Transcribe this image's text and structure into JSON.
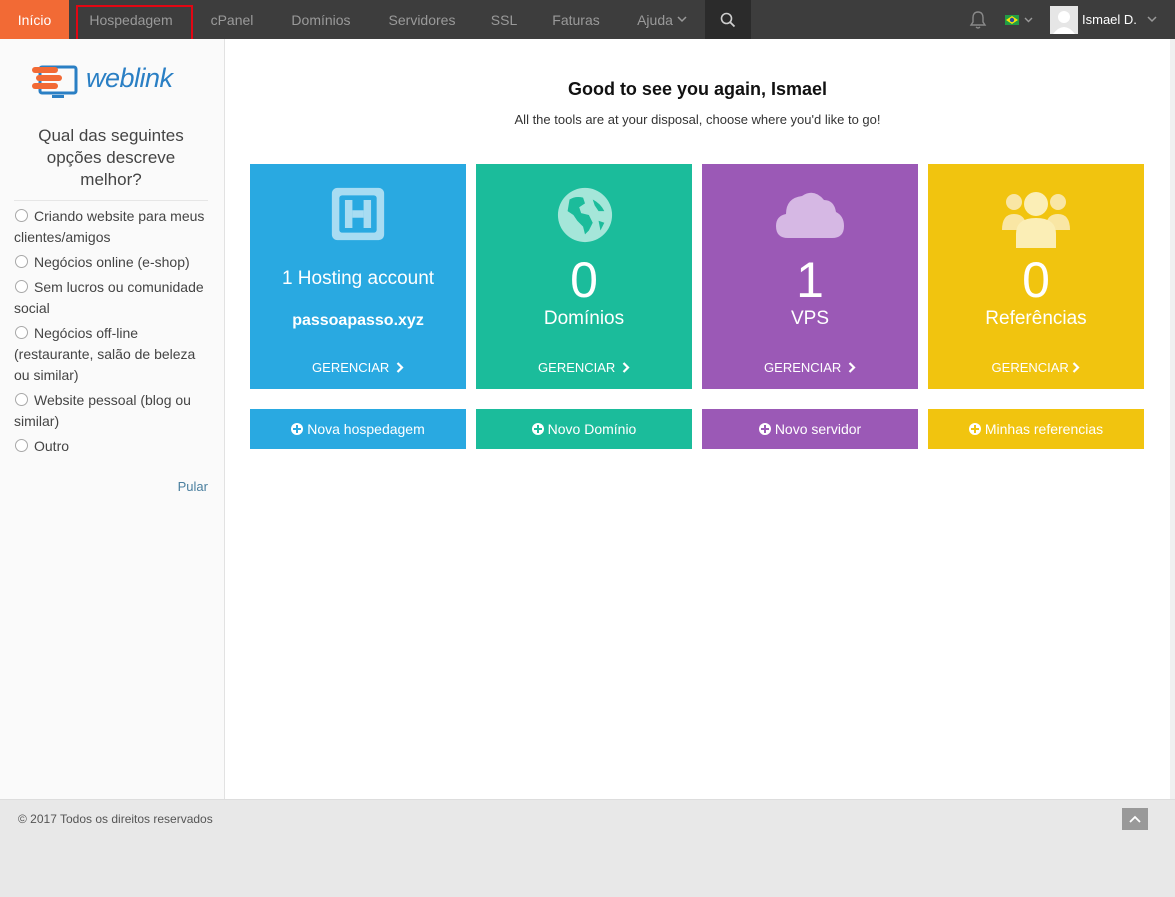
{
  "nav": {
    "items": [
      {
        "label": "Início",
        "active": true
      },
      {
        "label": "Hospedagem"
      },
      {
        "label": "cPanel"
      },
      {
        "label": "Domínios"
      },
      {
        "label": "Servidores"
      },
      {
        "label": "SSL"
      },
      {
        "label": "Faturas"
      },
      {
        "label": "Ajuda"
      }
    ],
    "user_name": "Ismael D.",
    "language_flag": "flag-brazil-icon",
    "accent_color": "#f26a35"
  },
  "sidebar": {
    "logo_text": "weblink",
    "question": "Qual das seguintes opções descreve melhor?",
    "options": [
      "Criando website para meus clientes/amigos",
      "Negócios online (e-shop)",
      "Sem lucros ou comunidade social",
      "Negócios off-line (restaurante, salão de beleza ou similar)",
      "Website pessoal (blog ou similar)",
      "Outro"
    ],
    "skip_label": "Pular"
  },
  "main": {
    "greeting": "Good to see you again, Ismael",
    "subtitle": "All the tools are at your disposal, choose where you'd like to go!",
    "cards": [
      {
        "title": "1 Hosting account",
        "domain": "passoapasso.xyz",
        "manage": "GERENCIAR",
        "color": "#29a9e1",
        "icon": "hosting-h-icon"
      },
      {
        "count": "0",
        "label": "Domínios",
        "manage": "GERENCIAR",
        "color": "#1bbc9b",
        "icon": "globe-icon"
      },
      {
        "count": "1",
        "label": "VPS",
        "manage": "GERENCIAR",
        "color": "#9b59b6",
        "icon": "cloud-icon"
      },
      {
        "count": "0",
        "label": "Referências",
        "manage": "GERENCIAR",
        "color": "#f1c40f",
        "icon": "users-icon"
      }
    ],
    "buttons": [
      {
        "label": "Nova hospedagem"
      },
      {
        "label": "Novo Domínio"
      },
      {
        "label": "Novo servidor"
      },
      {
        "label": "Minhas referencias"
      }
    ]
  },
  "footer": {
    "copyright": "© 2017 Todos os direitos reservados"
  }
}
